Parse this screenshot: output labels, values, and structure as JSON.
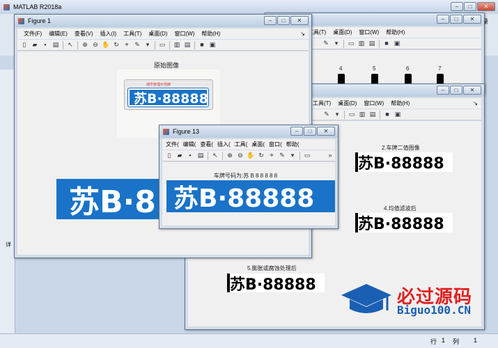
{
  "matlab": {
    "title": "MATLAB R2018a",
    "status_row": "行",
    "status_row_val": "1",
    "status_col": "列",
    "status_col_val": "1",
    "right_tab": "录",
    "side_label": "详"
  },
  "menus": {
    "file": "文件(F)",
    "edit": "编辑(E)",
    "view": "查看(V)",
    "insert": "插入(I)",
    "tools": "工具(T)",
    "desktop": "桌面(D)",
    "window": "窗口(W)",
    "help": "帮助(H)",
    "dock": "↘"
  },
  "menus_small": {
    "file": "文件(",
    "edit": "编辑(",
    "view": "查看(",
    "insert": "插入(",
    "tools": "工具(",
    "desktop": "桌面(",
    "window": "窗口(",
    "help": "帮助(",
    "more": "»"
  },
  "fig1": {
    "title": "Figure 1",
    "img_title": "原始图像",
    "plate_text": "苏B·88888",
    "banner": "城市管理示范牌",
    "big_plate": "苏B·8"
  },
  "fig13": {
    "title": "Figure 13",
    "result": "车牌号码为:苏 B 8 8 8 8 8",
    "plate_text": "苏B·88888"
  },
  "back": {
    "labels": [
      "4",
      "5",
      "6",
      "7"
    ],
    "cap2": "2.车牌二值图像",
    "cap4": "4.均值滤波后",
    "cap5": "5.膨胀或腐蚀处理后",
    "bw_text": "苏B·88888"
  },
  "watermark": {
    "brand": "必过源码",
    "url": "Biguo100.CN"
  },
  "colors": {
    "plate_blue": "#1a73c8",
    "brand_blue": "#1a5fb4",
    "brand_red": "#e02020"
  }
}
